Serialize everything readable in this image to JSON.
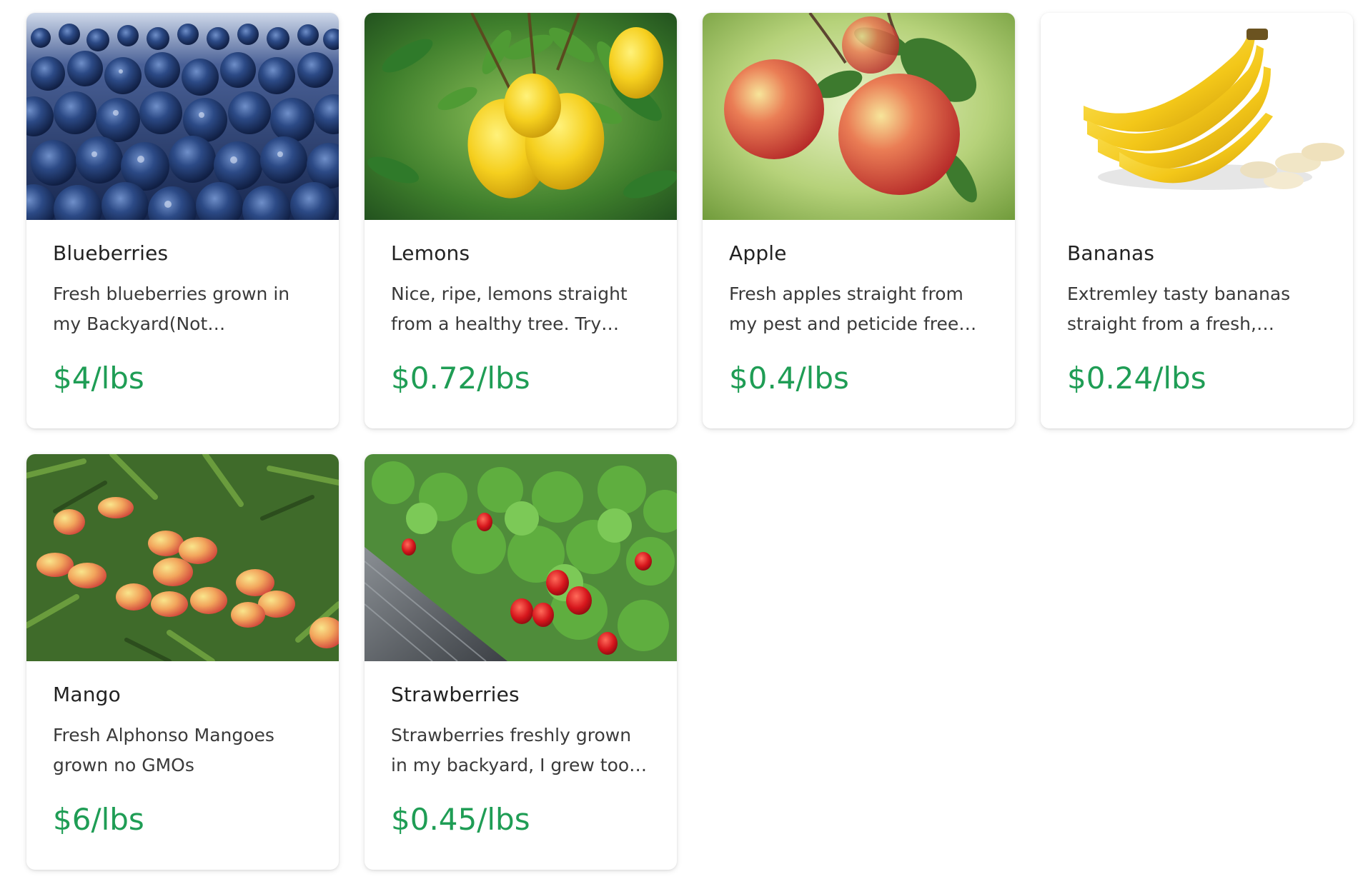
{
  "products": [
    {
      "name": "Blueberries",
      "description": "Fresh blueberries grown in my Backyard(Not Chemically...",
      "price": "$4/lbs",
      "image": "blueberries-photo"
    },
    {
      "name": "Lemons",
      "description": "Nice, ripe, lemons straight from a healthy tree. Try the...",
      "price": "$0.72/lbs",
      "image": "lemons-photo"
    },
    {
      "name": "Apple",
      "description": "Fresh apples straight from my pest and peticide free garde...",
      "price": "$0.4/lbs",
      "image": "apples-photo"
    },
    {
      "name": "Bananas",
      "description": "Extremley tasty bananas straight from a fresh, health...",
      "price": "$0.24/lbs",
      "image": "bananas-photo"
    },
    {
      "name": "Mango",
      "description": "Fresh Alphonso Mangoes grown no GMOs",
      "price": "$6/lbs",
      "image": "mangoes-photo"
    },
    {
      "name": "Strawberries",
      "description": "Strawberries freshly grown in my backyard, I grew too mu...",
      "price": "$0.45/lbs",
      "image": "strawberries-photo"
    }
  ],
  "colors": {
    "price": "#1f9d55",
    "title": "#222222",
    "description": "#3a3a3a"
  }
}
